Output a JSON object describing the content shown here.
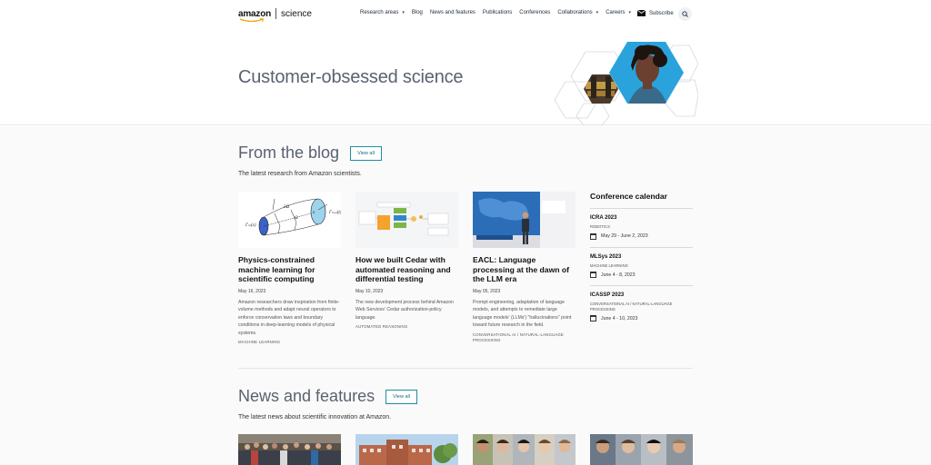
{
  "header": {
    "logo_amazon": "amazon",
    "logo_science": "science",
    "nav": [
      {
        "label": "Research areas",
        "dropdown": true
      },
      {
        "label": "Blog",
        "dropdown": false
      },
      {
        "label": "News and features",
        "dropdown": false
      },
      {
        "label": "Publications",
        "dropdown": false
      },
      {
        "label": "Conferences",
        "dropdown": false
      },
      {
        "label": "Collaborations",
        "dropdown": true
      },
      {
        "label": "Careers",
        "dropdown": true
      }
    ],
    "subscribe": "Subscribe",
    "chevron": "⌄"
  },
  "hero": {
    "title": "Customer-obsessed science"
  },
  "blog": {
    "title": "From the blog",
    "view_all": "View all",
    "subtitle": "The latest research from Amazon scientists.",
    "cards": [
      {
        "title": "Physics-constrained machine learning for scientific computing",
        "date": "May 16, 2023",
        "description": "Amazon researchers draw inspiration from finite-volume methods and adapt neural operators to enforce conservation laws and boundary conditions in deep-learning models of physical systems.",
        "tag": "MACHINE LEARNING"
      },
      {
        "title": "How we built Cedar with automated reasoning and differential testing",
        "date": "May 10, 2023",
        "description": "The new development process behind Amazon Web Services' Cedar authorization-policy language.",
        "tag": "AUTOMATED REASONING"
      },
      {
        "title": "EACL: Language processing at the dawn of the LLM era",
        "date": "May 05, 2023",
        "description": "Prompt engineering, adaptation of language models, and attempts to remediate large language models' (LLMs') \"hallucinations\" point toward future research in the field.",
        "tag": "CONVERSATIONAL AI / NATURAL-LANGUAGE PROCESSING"
      }
    ]
  },
  "conferences": {
    "title": "Conference calendar",
    "items": [
      {
        "name": "ICRA 2023",
        "tag": "ROBOTICS",
        "date": "May 29 - June 2, 2023"
      },
      {
        "name": "MLSys 2023",
        "tag": "MACHINE LEARNING",
        "date": "June 4 - 8, 2023"
      },
      {
        "name": "ICASSP 2023",
        "tag": "CONVERSATIONAL AI / NATURAL-LANGUAGE PROCESSING",
        "date": "June 4 - 10, 2023"
      }
    ]
  },
  "news": {
    "title": "News and features",
    "view_all": "View all",
    "subtitle": "The latest news about scientific innovation at Amazon."
  },
  "colors": {
    "accent": "#1d8fa0",
    "smile": "#f2a200",
    "hero_blue": "#2aa3dc"
  }
}
